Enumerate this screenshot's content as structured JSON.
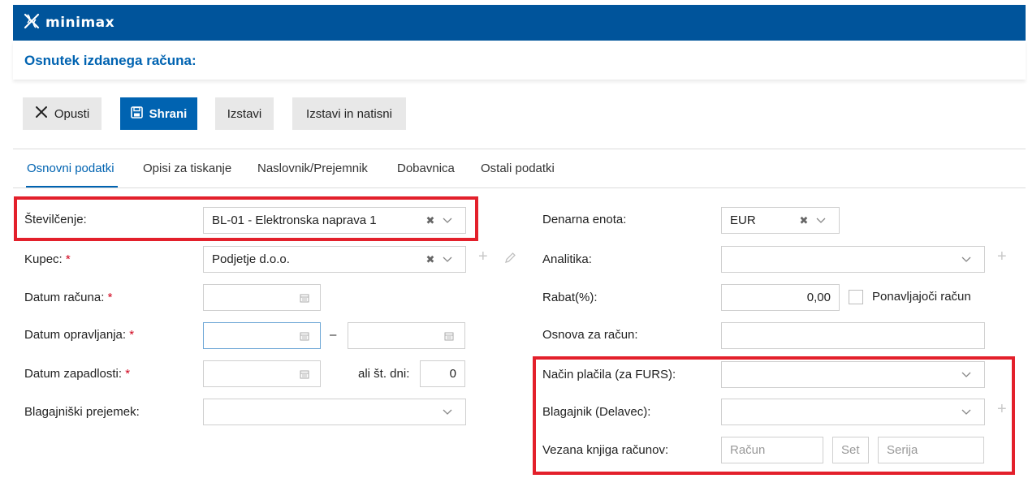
{
  "app": {
    "brand": "minimax",
    "brand_color": "#00549b",
    "accent_color": "#0063b1",
    "highlight_color": "#e3202b"
  },
  "page": {
    "title": "Osnutek izdanega računa:"
  },
  "toolbar": {
    "cancel_label": "Opusti",
    "save_label": "Shrani",
    "issue_label": "Izstavi",
    "issue_print_label": "Izstavi in natisni"
  },
  "tabs": [
    {
      "label": "Osnovni podatki",
      "active": true
    },
    {
      "label": "Opisi za tiskanje",
      "active": false
    },
    {
      "label": "Naslovnik/Prejemnik",
      "active": false
    },
    {
      "label": "Dobavnica",
      "active": false
    },
    {
      "label": "Ostali podatki",
      "active": false
    }
  ],
  "form_left": {
    "numbering": {
      "label": "Številčenje:",
      "value": "BL-01 - Elektronska naprava 1"
    },
    "customer": {
      "label": "Kupec:",
      "required": "*",
      "value": "Podjetje d.o.o."
    },
    "invoice_date": {
      "label": "Datum računa:",
      "required": "*"
    },
    "service_date": {
      "label": "Datum opravljanja:",
      "required": "*",
      "separator": "–"
    },
    "due_date": {
      "label": "Datum zapadlosti:",
      "required": "*",
      "days_label": "ali št. dni:",
      "days_value": "0"
    },
    "cash_receipt": {
      "label": "Blagajniški prejemek:"
    }
  },
  "form_right": {
    "currency": {
      "label": "Denarna enota:",
      "value": "EUR"
    },
    "analytics": {
      "label": "Analitika:"
    },
    "discount": {
      "label": "Rabat(%):",
      "value": "0,00"
    },
    "recurring": {
      "label": "Ponavljajoči račun"
    },
    "basis": {
      "label": "Osnova za račun:"
    },
    "payment_method": {
      "label": "Način plačila (za FURS):"
    },
    "cashier": {
      "label": "Blagajnik (Delavec):"
    },
    "invoice_book": {
      "label": "Vezana knjiga računov:",
      "invoice_placeholder": "Račun",
      "set_placeholder": "Set",
      "series_placeholder": "Serija"
    }
  }
}
